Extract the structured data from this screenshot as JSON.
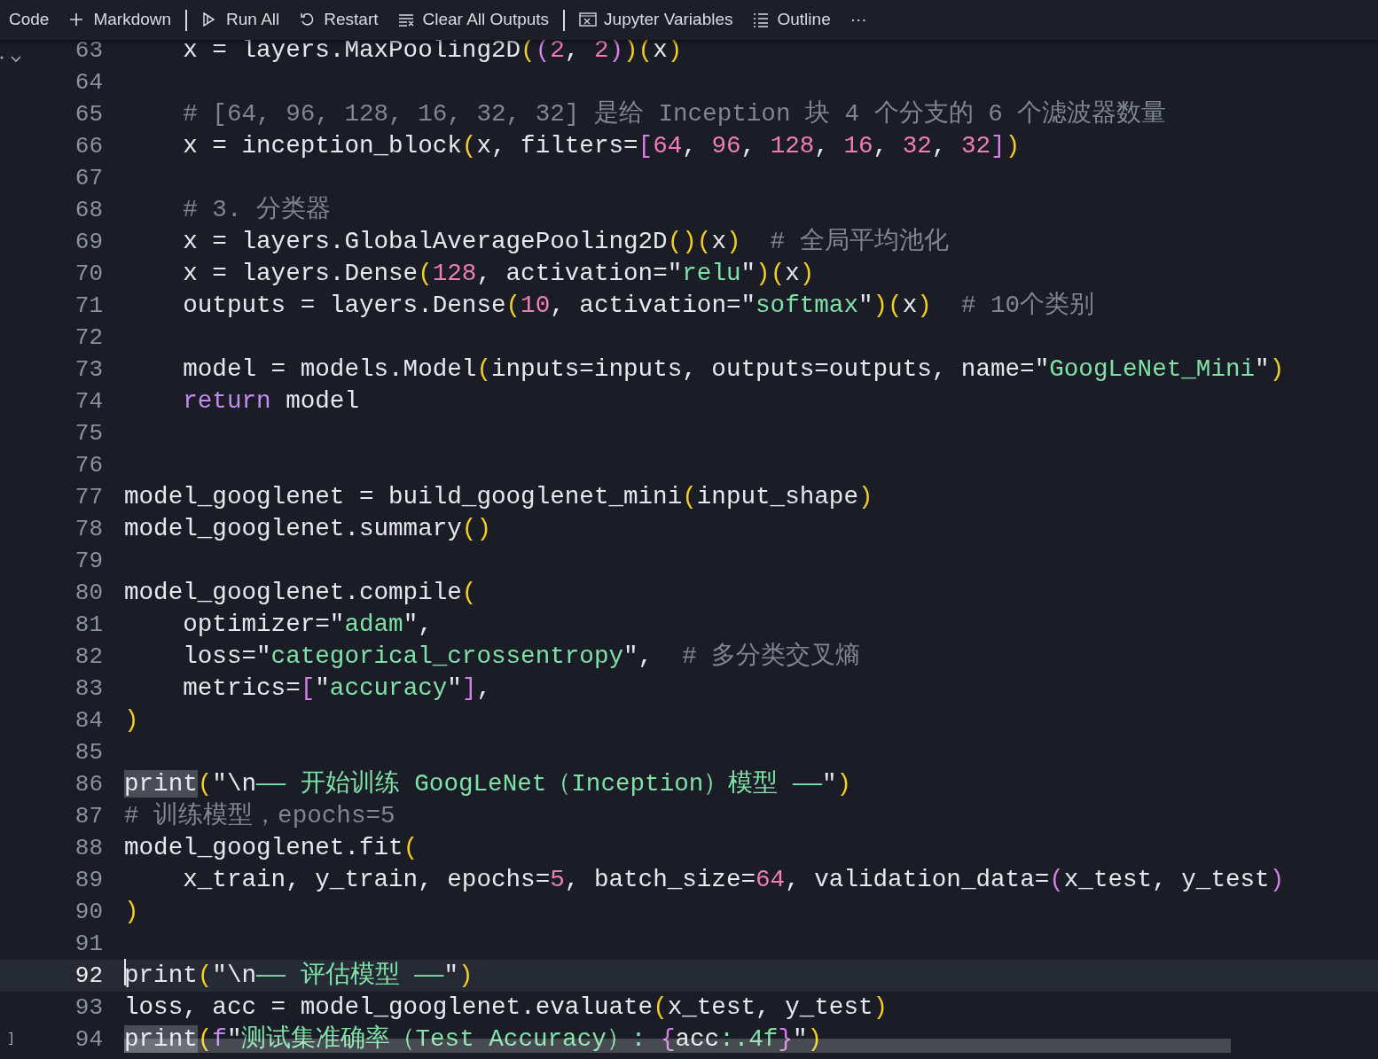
{
  "toolbar": {
    "items": [
      {
        "kind": "plain",
        "label": "Code",
        "separator_after": false
      },
      {
        "kind": "plus",
        "label": "Markdown",
        "separator_after": true
      },
      {
        "kind": "run",
        "label": "Run All",
        "separator_after": false
      },
      {
        "kind": "restart",
        "label": "Restart",
        "separator_after": false
      },
      {
        "kind": "clear",
        "label": "Clear All Outputs",
        "separator_after": true
      },
      {
        "kind": "variables",
        "label": "Jupyter Variables",
        "separator_after": false
      },
      {
        "kind": "outline",
        "label": "Outline",
        "separator_after": false
      },
      {
        "kind": "more",
        "label": "···",
        "separator_after": false
      }
    ]
  },
  "editor": {
    "lines": [
      {
        "number": "63",
        "current": false,
        "tokens": [
          {
            "kind": "plain",
            "text": "    x = layers.MaxPooling2D"
          },
          {
            "kind": "bracket1",
            "text": "("
          },
          {
            "kind": "bracket2",
            "text": "("
          },
          {
            "kind": "number",
            "text": "2"
          },
          {
            "kind": "plain",
            "text": ", "
          },
          {
            "kind": "number",
            "text": "2"
          },
          {
            "kind": "bracket2",
            "text": ")"
          },
          {
            "kind": "bracket1",
            "text": ")"
          },
          {
            "kind": "bracket1",
            "text": "("
          },
          {
            "kind": "plain",
            "text": "x"
          },
          {
            "kind": "bracket1",
            "text": ")"
          }
        ]
      },
      {
        "number": "64",
        "current": false
      },
      {
        "number": "65",
        "current": false,
        "tokens": [
          {
            "kind": "comment",
            "text": "    # [64, 96, 128, 16, 32, 32] 是给 Inception 块 4 个分支的 6 个滤波器数量"
          }
        ]
      },
      {
        "number": "66",
        "current": false,
        "tokens": [
          {
            "kind": "plain",
            "text": "    x = inception_block"
          },
          {
            "kind": "bracket1",
            "text": "("
          },
          {
            "kind": "plain",
            "text": "x, filters="
          },
          {
            "kind": "bracket2",
            "text": "["
          },
          {
            "kind": "number",
            "text": "64"
          },
          {
            "kind": "plain",
            "text": ", "
          },
          {
            "kind": "number",
            "text": "96"
          },
          {
            "kind": "plain",
            "text": ", "
          },
          {
            "kind": "number",
            "text": "128"
          },
          {
            "kind": "plain",
            "text": ", "
          },
          {
            "kind": "number",
            "text": "16"
          },
          {
            "kind": "plain",
            "text": ", "
          },
          {
            "kind": "number",
            "text": "32"
          },
          {
            "kind": "plain",
            "text": ", "
          },
          {
            "kind": "number",
            "text": "32"
          },
          {
            "kind": "bracket2",
            "text": "]"
          },
          {
            "kind": "bracket1",
            "text": ")"
          }
        ]
      },
      {
        "number": "67",
        "current": false
      },
      {
        "number": "68",
        "current": false,
        "tokens": [
          {
            "kind": "comment",
            "text": "    # 3. 分类器"
          }
        ]
      },
      {
        "number": "69",
        "current": false,
        "tokens": [
          {
            "kind": "plain",
            "text": "    x = layers.GlobalAveragePooling2D"
          },
          {
            "kind": "bracket1",
            "text": "()"
          },
          {
            "kind": "bracket1",
            "text": "("
          },
          {
            "kind": "plain",
            "text": "x"
          },
          {
            "kind": "bracket1",
            "text": ")"
          },
          {
            "kind": "comment",
            "text": "  # 全局平均池化"
          }
        ]
      },
      {
        "number": "70",
        "current": false,
        "tokens": [
          {
            "kind": "plain",
            "text": "    x = layers.Dense"
          },
          {
            "kind": "bracket1",
            "text": "("
          },
          {
            "kind": "number",
            "text": "128"
          },
          {
            "kind": "plain",
            "text": ", activation=\""
          },
          {
            "kind": "string",
            "text": "relu"
          },
          {
            "kind": "plain",
            "text": "\""
          },
          {
            "kind": "bracket1",
            "text": ")"
          },
          {
            "kind": "bracket1",
            "text": "("
          },
          {
            "kind": "plain",
            "text": "x"
          },
          {
            "kind": "bracket1",
            "text": ")"
          }
        ]
      },
      {
        "number": "71",
        "current": false,
        "tokens": [
          {
            "kind": "plain",
            "text": "    outputs = layers.Dense"
          },
          {
            "kind": "bracket1",
            "text": "("
          },
          {
            "kind": "number",
            "text": "10"
          },
          {
            "kind": "plain",
            "text": ", activation=\""
          },
          {
            "kind": "string",
            "text": "softmax"
          },
          {
            "kind": "plain",
            "text": "\""
          },
          {
            "kind": "bracket1",
            "text": ")"
          },
          {
            "kind": "bracket1",
            "text": "("
          },
          {
            "kind": "plain",
            "text": "x"
          },
          {
            "kind": "bracket1",
            "text": ")"
          },
          {
            "kind": "comment",
            "text": "  # 10个类别"
          }
        ]
      },
      {
        "number": "72",
        "current": false
      },
      {
        "number": "73",
        "current": false,
        "tokens": [
          {
            "kind": "plain",
            "text": "    model = models.Model"
          },
          {
            "kind": "bracket1",
            "text": "("
          },
          {
            "kind": "plain",
            "text": "inputs=inputs, outputs=outputs, name=\""
          },
          {
            "kind": "string",
            "text": "GoogLeNet_Mini"
          },
          {
            "kind": "plain",
            "text": "\""
          },
          {
            "kind": "bracket1",
            "text": ")"
          }
        ]
      },
      {
        "number": "74",
        "current": false,
        "tokens": [
          {
            "kind": "keyword",
            "text": "    return"
          },
          {
            "kind": "plain",
            "text": " model"
          }
        ]
      },
      {
        "number": "75",
        "current": false
      },
      {
        "number": "76",
        "current": false
      },
      {
        "number": "77",
        "current": false,
        "tokens": [
          {
            "kind": "plain",
            "text": "model_googlenet = build_googlenet_mini"
          },
          {
            "kind": "bracket1",
            "text": "("
          },
          {
            "kind": "plain",
            "text": "input_shape"
          },
          {
            "kind": "bracket1",
            "text": ")"
          }
        ]
      },
      {
        "number": "78",
        "current": false,
        "tokens": [
          {
            "kind": "plain",
            "text": "model_googlenet.summary"
          },
          {
            "kind": "bracket1",
            "text": "()"
          }
        ]
      },
      {
        "number": "79",
        "current": false
      },
      {
        "number": "80",
        "current": false,
        "tokens": [
          {
            "kind": "plain",
            "text": "model_googlenet.compile"
          },
          {
            "kind": "bracket1",
            "text": "("
          }
        ]
      },
      {
        "number": "81",
        "current": false,
        "tokens": [
          {
            "kind": "plain",
            "text": "    optimizer=\""
          },
          {
            "kind": "string",
            "text": "adam"
          },
          {
            "kind": "plain",
            "text": "\","
          }
        ]
      },
      {
        "number": "82",
        "current": false,
        "tokens": [
          {
            "kind": "plain",
            "text": "    loss=\""
          },
          {
            "kind": "string",
            "text": "categorical_crossentropy"
          },
          {
            "kind": "plain",
            "text": "\",  "
          },
          {
            "kind": "comment",
            "text": "# 多分类交叉熵"
          }
        ]
      },
      {
        "number": "83",
        "current": false,
        "tokens": [
          {
            "kind": "plain",
            "text": "    metrics="
          },
          {
            "kind": "bracket2",
            "text": "["
          },
          {
            "kind": "plain",
            "text": "\""
          },
          {
            "kind": "string",
            "text": "accuracy"
          },
          {
            "kind": "plain",
            "text": "\""
          },
          {
            "kind": "bracket2",
            "text": "]"
          },
          {
            "kind": "plain",
            "text": ","
          }
        ]
      },
      {
        "number": "84",
        "current": false,
        "tokens": [
          {
            "kind": "bracket1",
            "text": ")"
          }
        ]
      },
      {
        "number": "85",
        "current": false
      },
      {
        "number": "86",
        "current": false,
        "tokens": [
          {
            "kind": "highlight",
            "text": "print"
          },
          {
            "kind": "bracket1",
            "text": "("
          },
          {
            "kind": "plain",
            "text": "\"\\n"
          },
          {
            "kind": "string",
            "text": "—— 开始训练 GoogLeNet（Inception）模型 ——"
          },
          {
            "kind": "plain",
            "text": "\""
          },
          {
            "kind": "bracket1",
            "text": ")"
          }
        ]
      },
      {
        "number": "87",
        "current": false,
        "tokens": [
          {
            "kind": "comment",
            "text": "# 训练模型，epochs=5"
          }
        ]
      },
      {
        "number": "88",
        "current": false,
        "tokens": [
          {
            "kind": "plain",
            "text": "model_googlenet.fit"
          },
          {
            "kind": "bracket1",
            "text": "("
          }
        ]
      },
      {
        "number": "89",
        "current": false,
        "tokens": [
          {
            "kind": "plain",
            "text": "    x_train, y_train, epochs="
          },
          {
            "kind": "number",
            "text": "5"
          },
          {
            "kind": "plain",
            "text": ", batch_size="
          },
          {
            "kind": "number",
            "text": "64"
          },
          {
            "kind": "plain",
            "text": ", validation_data="
          },
          {
            "kind": "bracket2",
            "text": "("
          },
          {
            "kind": "plain",
            "text": "x_test, y_test"
          },
          {
            "kind": "bracket2",
            "text": ")"
          }
        ]
      },
      {
        "number": "90",
        "current": false,
        "tokens": [
          {
            "kind": "bracket1",
            "text": ")"
          }
        ]
      },
      {
        "number": "91",
        "current": false
      },
      {
        "number": "92",
        "current": true,
        "tokens": [
          {
            "kind": "plain",
            "text": "print"
          },
          {
            "kind": "bracket1",
            "text": "("
          },
          {
            "kind": "plain",
            "text": "\"\\n"
          },
          {
            "kind": "string",
            "text": "—— 评估模型 ——"
          },
          {
            "kind": "plain",
            "text": "\""
          },
          {
            "kind": "bracket1",
            "text": ")"
          }
        ]
      },
      {
        "number": "93",
        "current": false,
        "tokens": [
          {
            "kind": "plain",
            "text": "loss, acc = model_googlenet.evaluate"
          },
          {
            "kind": "bracket1",
            "text": "("
          },
          {
            "kind": "plain",
            "text": "x_test, y_test"
          },
          {
            "kind": "bracket1",
            "text": ")"
          }
        ]
      },
      {
        "number": "94",
        "current": false,
        "gutter_mark": "]",
        "tokens": [
          {
            "kind": "highlight",
            "text": "print"
          },
          {
            "kind": "bracket1",
            "text": "("
          },
          {
            "kind": "keyword",
            "text": "f"
          },
          {
            "kind": "plain",
            "text": "\""
          },
          {
            "kind": "string",
            "text": "测试集准确率（Test Accuracy）: "
          },
          {
            "kind": "bracket2",
            "text": "{"
          },
          {
            "kind": "plain",
            "text": "acc"
          },
          {
            "kind": "string",
            "text": ":.4f"
          },
          {
            "kind": "bracket2",
            "text": "}"
          },
          {
            "kind": "plain",
            "text": "\""
          },
          {
            "kind": "bracket1",
            "text": ")"
          }
        ]
      }
    ]
  }
}
